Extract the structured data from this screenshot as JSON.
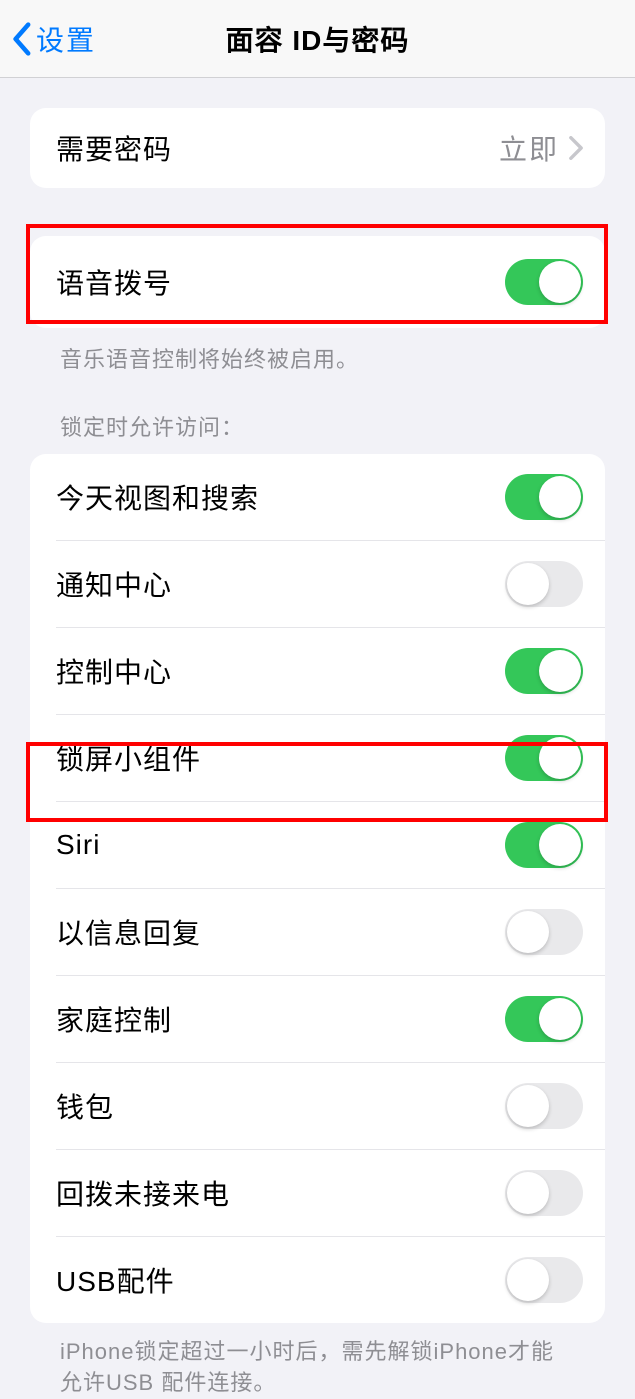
{
  "nav": {
    "back_label": "设置",
    "title": "面容 ID与密码"
  },
  "passcode_section": {
    "require_label": "需要密码",
    "require_value": "立即"
  },
  "voice_dial": {
    "label": "语音拨号",
    "footer": "音乐语音控制将始终被启用。",
    "on": true
  },
  "locked_access": {
    "header": "锁定时允许访问：",
    "items": [
      {
        "label": "今天视图和搜索",
        "on": true
      },
      {
        "label": "通知中心",
        "on": false
      },
      {
        "label": "控制中心",
        "on": true
      },
      {
        "label": "锁屏小组件",
        "on": true
      },
      {
        "label": "Siri",
        "on": true
      },
      {
        "label": "以信息回复",
        "on": false
      },
      {
        "label": "家庭控制",
        "on": true
      },
      {
        "label": "钱包",
        "on": false
      },
      {
        "label": "回拨未接来电",
        "on": false
      },
      {
        "label": "USB配件",
        "on": false
      }
    ],
    "footer": "iPhone锁定超过一小时后，需先解锁iPhone才能允许USB 配件连接。"
  }
}
